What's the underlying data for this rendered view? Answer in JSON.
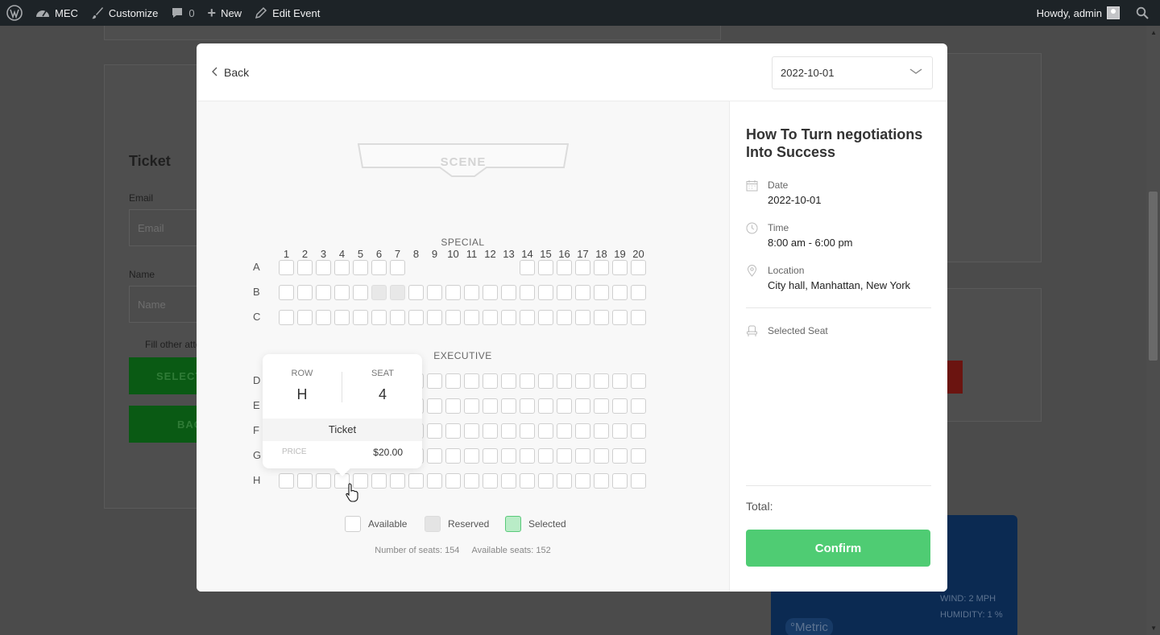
{
  "adminbar": {
    "site_name": "MEC",
    "customize": "Customize",
    "comments_count": "0",
    "new_label": "New",
    "edit_label": "Edit Event",
    "howdy": "Howdy, admin"
  },
  "background": {
    "ticket_heading": "Ticket",
    "email_label": "Email",
    "email_placeholder": "Email",
    "name_label": "Name",
    "name_placeholder": "Name",
    "fill_other": "Fill other atte",
    "select_btn": "SELECT",
    "back_btn": "BAC",
    "wind": "WIND: 2 MPH",
    "humidity": "HUMIDITY: 1 %",
    "metric": "°Metric"
  },
  "modal": {
    "back_label": "Back",
    "date_value": "2022-10-01",
    "stage_label": "SCENE",
    "columns": [
      "1",
      "2",
      "3",
      "4",
      "5",
      "6",
      "7",
      "8",
      "9",
      "10",
      "11",
      "12",
      "13",
      "14",
      "15",
      "16",
      "17",
      "18",
      "19",
      "20"
    ],
    "sections": [
      {
        "label": "SPECIAL",
        "rows": [
          "A",
          "B",
          "C"
        ]
      },
      {
        "label": "EXECUTIVE",
        "rows": [
          "D",
          "E",
          "F",
          "G",
          "H"
        ]
      }
    ],
    "tooltip": {
      "row_key": "ROW",
      "row_value": "H",
      "seat_key": "SEAT",
      "seat_value": "4",
      "ticket": "Ticket",
      "price_key": "PRICE",
      "price_value": "$20.00"
    },
    "legend": {
      "available": "Available",
      "reserved": "Reserved",
      "selected": "Selected"
    },
    "stats": {
      "number_of_seats": "Number of seats: 154",
      "available_seats": "Available seats: 152"
    },
    "event": {
      "title": "How To Turn negotiations Into Success",
      "date_key": "Date",
      "date_value": "2022-10-01",
      "time_key": "Time",
      "time_value": "8:00 am - 6:00 pm",
      "location_key": "Location",
      "location_value": "City hall, Manhattan, New York",
      "selected_seat_key": "Selected Seat",
      "total_label": "Total:",
      "confirm_label": "Confirm"
    },
    "colors": {
      "confirm": "#4fcc73",
      "selected_legend": "#b9ecc7"
    }
  }
}
